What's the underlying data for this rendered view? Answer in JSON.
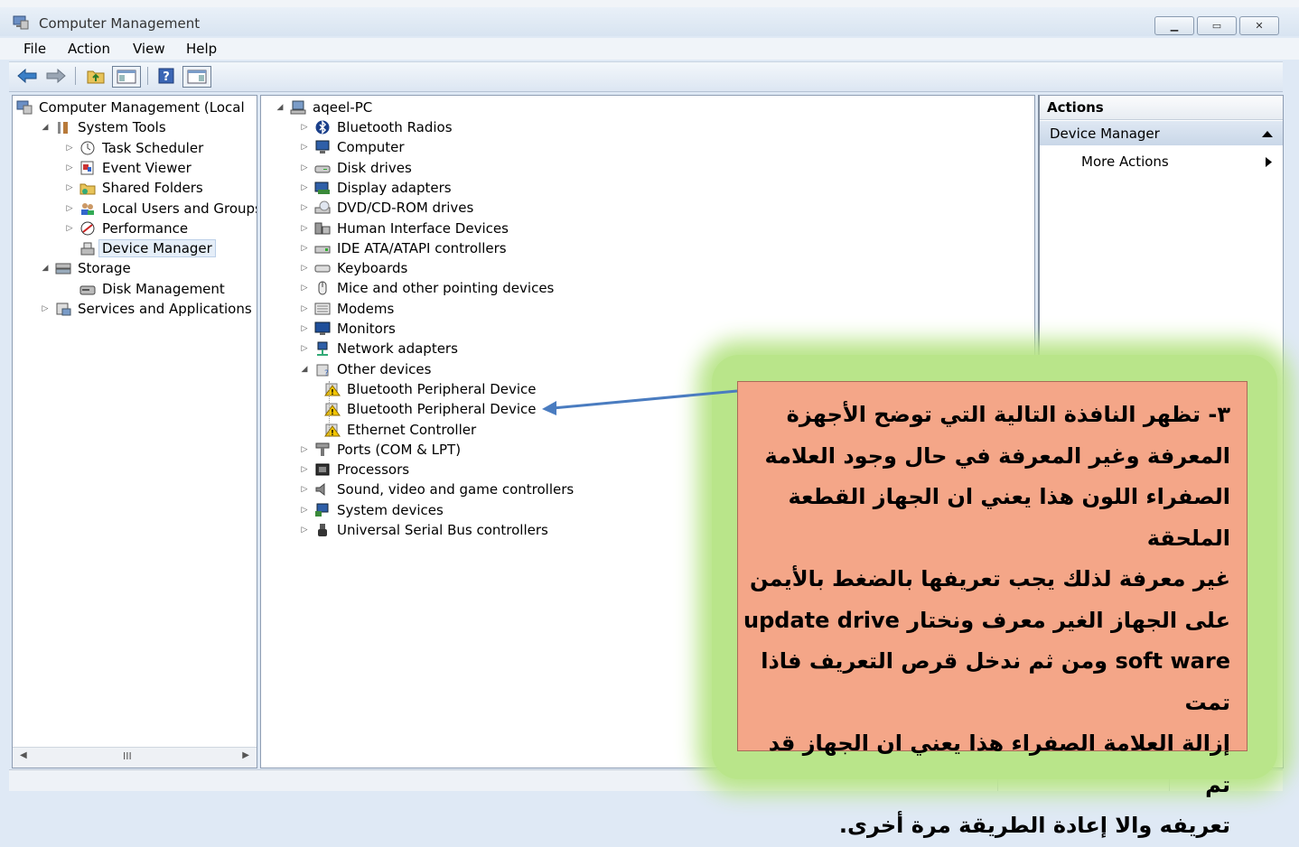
{
  "window": {
    "title": "Computer Management",
    "controls": [
      "▁",
      "▭",
      "✕"
    ]
  },
  "menubar": [
    "File",
    "Action",
    "View",
    "Help"
  ],
  "left_tree": [
    {
      "label": "Computer Management (Local",
      "expander": "",
      "icon": "computer-management-icon",
      "selected": false
    },
    {
      "label": "System Tools",
      "expander": "◢",
      "icon": "system-tools-icon",
      "selected": false
    },
    {
      "label": "Task Scheduler",
      "expander": "▷",
      "icon": "clock-icon",
      "selected": false
    },
    {
      "label": "Event Viewer",
      "expander": "▷",
      "icon": "event-viewer-icon",
      "selected": false
    },
    {
      "label": "Shared Folders",
      "expander": "▷",
      "icon": "shared-folder-icon",
      "selected": false
    },
    {
      "label": "Local Users and Groups",
      "expander": "▷",
      "icon": "users-icon",
      "selected": false
    },
    {
      "label": "Performance",
      "expander": "▷",
      "icon": "performance-icon",
      "selected": false
    },
    {
      "label": "Device Manager",
      "expander": "",
      "icon": "device-manager-icon",
      "selected": true
    },
    {
      "label": "Storage",
      "expander": "◢",
      "icon": "storage-icon",
      "selected": false
    },
    {
      "label": "Disk Management",
      "expander": "",
      "icon": "disk-management-icon",
      "selected": false
    },
    {
      "label": "Services and Applications",
      "expander": "▷",
      "icon": "services-icon",
      "selected": false
    }
  ],
  "device_tree": {
    "root": "aqeel-PC",
    "items": [
      {
        "label": "Bluetooth Radios",
        "icon": "bluetooth-icon",
        "level": 1,
        "expander": "▷"
      },
      {
        "label": "Computer",
        "icon": "computer-icon",
        "level": 1,
        "expander": "▷"
      },
      {
        "label": "Disk drives",
        "icon": "disk-drive-icon",
        "level": 1,
        "expander": "▷"
      },
      {
        "label": "Display adapters",
        "icon": "display-adapter-icon",
        "level": 1,
        "expander": "▷"
      },
      {
        "label": "DVD/CD-ROM drives",
        "icon": "dvd-icon",
        "level": 1,
        "expander": "▷"
      },
      {
        "label": "Human Interface Devices",
        "icon": "hid-icon",
        "level": 1,
        "expander": "▷"
      },
      {
        "label": "IDE ATA/ATAPI controllers",
        "icon": "ide-controller-icon",
        "level": 1,
        "expander": "▷"
      },
      {
        "label": "Keyboards",
        "icon": "keyboard-icon",
        "level": 1,
        "expander": "▷"
      },
      {
        "label": "Mice and other pointing devices",
        "icon": "mouse-icon",
        "level": 1,
        "expander": "▷"
      },
      {
        "label": "Modems",
        "icon": "modem-icon",
        "level": 1,
        "expander": "▷"
      },
      {
        "label": "Monitors",
        "icon": "monitor-icon",
        "level": 1,
        "expander": "▷"
      },
      {
        "label": "Network adapters",
        "icon": "network-adapter-icon",
        "level": 1,
        "expander": "▷"
      },
      {
        "label": "Other devices",
        "icon": "other-devices-icon",
        "level": 1,
        "expander": "◢"
      },
      {
        "label": "Bluetooth Peripheral Device",
        "icon": "unknown-device-warning-icon",
        "level": 2,
        "expander": ""
      },
      {
        "label": "Bluetooth Peripheral Device",
        "icon": "unknown-device-warning-icon",
        "level": 2,
        "expander": ""
      },
      {
        "label": "Ethernet Controller",
        "icon": "unknown-device-warning-icon",
        "level": 2,
        "expander": ""
      },
      {
        "label": "Ports (COM & LPT)",
        "icon": "port-icon",
        "level": 1,
        "expander": "▷"
      },
      {
        "label": "Processors",
        "icon": "processor-icon",
        "level": 1,
        "expander": "▷"
      },
      {
        "label": "Sound, video and game controllers",
        "icon": "sound-icon",
        "level": 1,
        "expander": "▷"
      },
      {
        "label": "System devices",
        "icon": "system-devices-icon",
        "level": 1,
        "expander": "▷"
      },
      {
        "label": "Universal Serial Bus controllers",
        "icon": "usb-icon",
        "level": 1,
        "expander": "▷"
      }
    ]
  },
  "actions": {
    "header": "Actions",
    "section": "Device Manager",
    "more": "More Actions"
  },
  "annotation": {
    "lines": [
      "٣- تظهر النافذة التالية التي توضح الأجهزة",
      "المعرفة وغير المعرفة في حال وجود العلامة",
      "الصفراء اللون هذا يعني ان الجهاز القطعة الملحقة",
      "غير معرفة لذلك يجب تعريفها  بالضغط بالأيمن",
      "على الجهاز الغير معرف ونختار  update drive",
      "soft ware ومن ثم ندخل قرص التعريف فاذا تمت",
      "إزالة العلامة الصفراء هذا يعني ان الجهاز قد تم",
      "تعريفه والا إعادة الطريقة مرة أخرى."
    ]
  },
  "colors": {
    "callout_fill": "#f4a688",
    "callout_glow": "#b9e58a",
    "arrow": "#4a7cc0",
    "warning": "#f2c500"
  },
  "scrollbar": {
    "thumb_glyph": "III"
  }
}
